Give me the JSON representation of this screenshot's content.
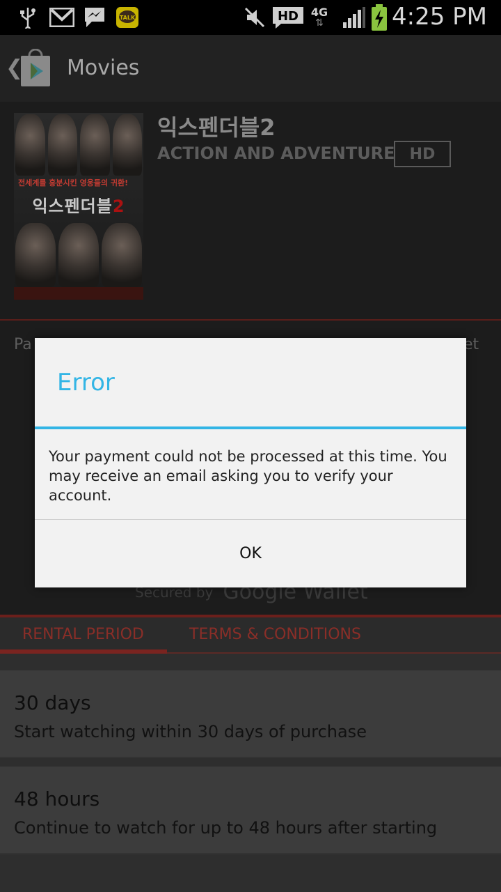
{
  "status_bar": {
    "time": "4:25 PM",
    "network": "4G",
    "hd_icon": "HD",
    "talk_icon": "TALK",
    "icons": [
      "usb-icon",
      "gmail-icon",
      "messenger-icon",
      "kakaotalk-icon",
      "mute-icon",
      "hd-voice-icon",
      "4g-icon",
      "signal-icon",
      "battery-charging-icon"
    ]
  },
  "app_bar": {
    "title": "Movies",
    "icon": "play-store-icon"
  },
  "movie": {
    "title": "익스펜더블2",
    "genre": "ACTION AND ADVENTURE",
    "badge": "HD",
    "poster_tagline": "전세계를 흥분시킨 영웅들의 귀환!",
    "poster_title": "익스펜더블",
    "poster_number": "2"
  },
  "payment": {
    "label": "Pa",
    "method_suffix": "et",
    "secured_by": "Secured by",
    "wallet": "Google Wallet"
  },
  "tabs": [
    {
      "label": "RENTAL PERIOD"
    },
    {
      "label": "TERMS & CONDITIONS"
    }
  ],
  "rental_options": [
    {
      "title": "30 days",
      "description": "Start watching within 30 days of purchase"
    },
    {
      "title": "48 hours",
      "description": "Continue to watch for up to 48 hours after starting"
    }
  ],
  "dialog": {
    "title": "Error",
    "message": "Your payment could not be processed at this time. You may receive an email asking you to verify your account.",
    "ok_label": "OK"
  },
  "colors": {
    "accent": "#33b5e5",
    "tab_red": "#8a2e28"
  }
}
